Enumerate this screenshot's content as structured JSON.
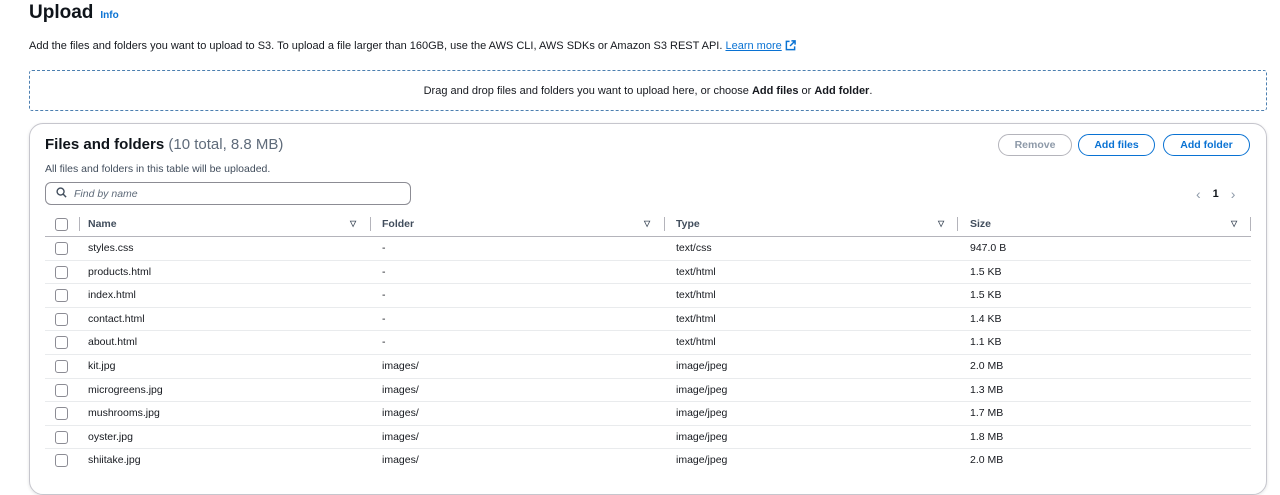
{
  "header": {
    "title": "Upload",
    "info_label": "Info"
  },
  "description": {
    "text": "Add the files and folders you want to upload to S3. To upload a file larger than 160GB, use the AWS CLI, AWS SDKs or Amazon S3 REST API.",
    "link_label": "Learn more"
  },
  "dropzone": {
    "prefix": "Drag and drop files and folders you want to upload here, or choose",
    "add_files": "Add files",
    "or": "or",
    "add_folder": "Add folder",
    "suffix": "."
  },
  "panel": {
    "title": "Files and folders",
    "count": "(10 total, 8.8 MB)",
    "subtitle": "All files and folders in this table will be uploaded.",
    "remove_label": "Remove",
    "add_files_label": "Add files",
    "add_folder_label": "Add folder",
    "search_placeholder": "Find by name",
    "page": "1",
    "columns": [
      "Name",
      "Folder",
      "Type",
      "Size"
    ],
    "rows": [
      {
        "name": "styles.css",
        "folder": "-",
        "type": "text/css",
        "size": "947.0 B"
      },
      {
        "name": "products.html",
        "folder": "-",
        "type": "text/html",
        "size": "1.5 KB"
      },
      {
        "name": "index.html",
        "folder": "-",
        "type": "text/html",
        "size": "1.5 KB"
      },
      {
        "name": "contact.html",
        "folder": "-",
        "type": "text/html",
        "size": "1.4 KB"
      },
      {
        "name": "about.html",
        "folder": "-",
        "type": "text/html",
        "size": "1.1 KB"
      },
      {
        "name": "kit.jpg",
        "folder": "images/",
        "type": "image/jpeg",
        "size": "2.0 MB"
      },
      {
        "name": "microgreens.jpg",
        "folder": "images/",
        "type": "image/jpeg",
        "size": "1.3 MB"
      },
      {
        "name": "mushrooms.jpg",
        "folder": "images/",
        "type": "image/jpeg",
        "size": "1.7 MB"
      },
      {
        "name": "oyster.jpg",
        "folder": "images/",
        "type": "image/jpeg",
        "size": "1.8 MB"
      },
      {
        "name": "shiitake.jpg",
        "folder": "images/",
        "type": "image/jpeg",
        "size": "2.0 MB"
      }
    ]
  },
  "colors": {
    "accent": "#0972d3",
    "text": "#16191f",
    "border": "#c6c6cd"
  },
  "icons": [
    "external-link-icon",
    "search-icon",
    "sort-icon",
    "chevron-left-icon",
    "chevron-right-icon"
  ]
}
